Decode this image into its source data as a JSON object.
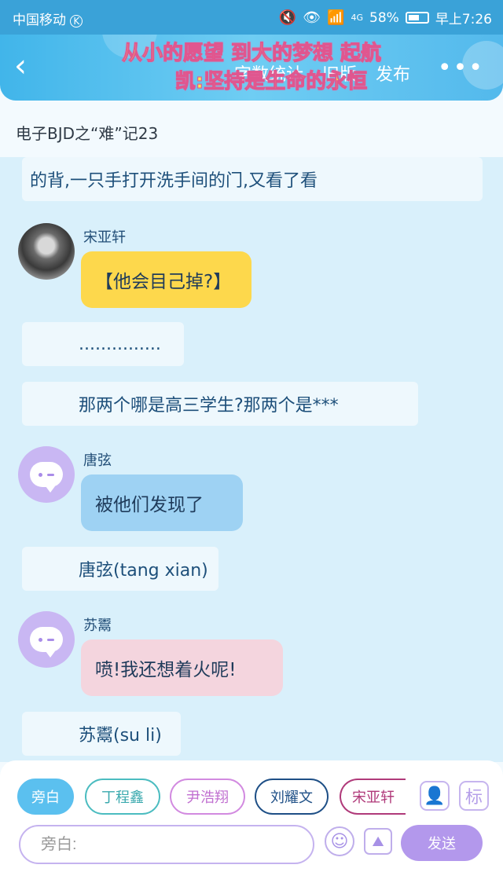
{
  "status_bar": {
    "carrier": "中国移动",
    "carrier_badge": "K",
    "network": "4G",
    "battery": "58%",
    "time": "早上7:26"
  },
  "header": {
    "banner_line1": "从小的愿望 到大的梦想 起航",
    "banner_line2": "凯:坚持是生命的永恒",
    "nav": [
      "字数统计",
      "旧版",
      "发布"
    ],
    "back_icon": "chevron-left-icon",
    "more_icon": "more-icon"
  },
  "page_title": "电子BJD之“难”记23",
  "messages": {
    "narration_top": "的背,一只手打开洗手间的门,又看了看",
    "song": {
      "sender": "宋亚轩",
      "text": "【他会目己掉?】"
    },
    "dots": "...............",
    "question": "那两个哪是高三学生?那两个是***",
    "tang": {
      "sender": "唐弦",
      "text": "被他们发现了"
    },
    "tang_name": "唐弦(tang xian)",
    "su": {
      "sender": "苏鬻",
      "text": "喷!我还想着火呢!"
    },
    "su_name": "苏鬻(su li)"
  },
  "characters": [
    {
      "label": "旁白",
      "color": "#5bc0ef",
      "selected": true
    },
    {
      "label": "丁程鑫",
      "color": "#4bbcc0",
      "selected": false
    },
    {
      "label": "尹浩翔",
      "color": "#d28ae0",
      "selected": false
    },
    {
      "label": "刘耀文",
      "color": "#1e4f86",
      "selected": false
    },
    {
      "label": "宋亚轩",
      "color": "#b03a7a",
      "selected": false
    }
  ],
  "input": {
    "placeholder": "旁白:"
  },
  "send_label": "发送",
  "mark_label": "标",
  "icons": [
    "person-card-icon",
    "emoji-icon",
    "image-icon"
  ]
}
